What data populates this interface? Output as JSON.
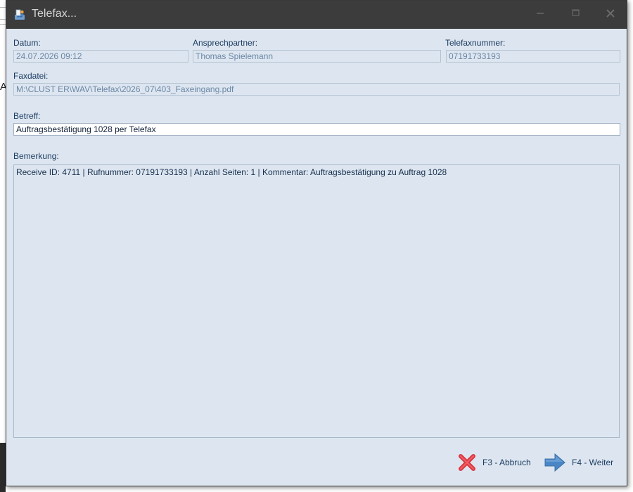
{
  "window": {
    "title": "Telefax...",
    "icons": {
      "app": "fax-app-icon",
      "minimize": "minimize-icon",
      "maximize": "maximize-icon",
      "close": "close-icon"
    }
  },
  "background": {
    "glyph": "A"
  },
  "form": {
    "datum": {
      "label": "Datum:",
      "value": "24.07.2026 09:12"
    },
    "ansprechpartner": {
      "label": "Ansprechpartner:",
      "value": "Thomas Spielemann"
    },
    "telefaxnummer": {
      "label": "Telefaxnummer:",
      "value": "07191733193"
    },
    "faxdatei": {
      "label": "Faxdatei:",
      "value": "M:\\CLUST ER\\WAV\\Telefax\\2026_07\\403_Faxeingang.pdf"
    },
    "betreff": {
      "label": "Betreff:",
      "value": "Auftragsbestätigung 1028 per Telefax"
    },
    "bemerkung": {
      "label": "Bemerkung:",
      "value": "Receive ID: 4711 | Rufnummer: 07191733193 | Anzahl Seiten: 1 | Kommentar: Auftragsbestätigung zu Auftrag 1028"
    }
  },
  "footer": {
    "cancel": {
      "label": "F3 - Abbruch",
      "icon": "red-x-icon",
      "color": "#d9363e"
    },
    "next": {
      "label": "F4 - Weiter",
      "icon": "blue-arrow-right-icon",
      "color": "#4a86c5"
    }
  },
  "colors": {
    "titlebar": "#3c3c3c",
    "window_bg": "#dde6f0",
    "label_text": "#1d3c62"
  }
}
